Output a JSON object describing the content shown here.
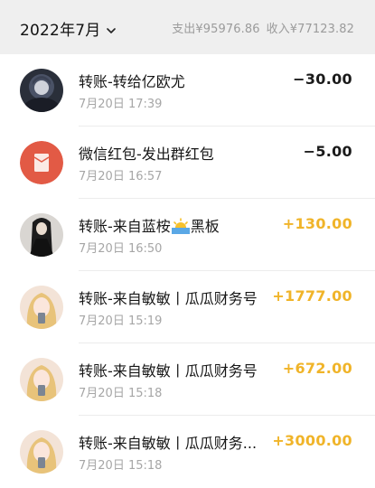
{
  "header": {
    "month": "2022年7月",
    "expense": "支出¥95976.86",
    "income": "收入¥77123.82",
    "month_icon": "chevron-down-icon"
  },
  "colors": {
    "expense_amount": "#1a1a1a",
    "income_amount": "#f0b429",
    "red_packet_bg": "#e25a45"
  },
  "transactions": [
    {
      "title": "转账-转给亿欧尤",
      "time": "7月20日 17:39",
      "amount": "−30.00",
      "type": "expense",
      "avatar": "user-avatar"
    },
    {
      "title": "微信红包-发出群红包",
      "time": "7月20日 16:57",
      "amount": "−5.00",
      "type": "expense",
      "avatar": "red-packet-icon"
    },
    {
      "title_before": "转账-来自蓝桉",
      "title_after": "黑板",
      "emoji": "sunrise-icon",
      "time": "7月20日 16:50",
      "amount": "+130.00",
      "type": "income",
      "avatar": "user-avatar"
    },
    {
      "title": "转账-来自敏敏丨瓜瓜财务号",
      "time": "7月20日 15:19",
      "amount": "+1777.00",
      "type": "income",
      "avatar": "user-avatar"
    },
    {
      "title": "转账-来自敏敏丨瓜瓜财务号",
      "time": "7月20日 15:18",
      "amount": "+672.00",
      "type": "income",
      "avatar": "user-avatar"
    },
    {
      "title": "转账-来自敏敏丨瓜瓜财务...",
      "time": "7月20日 15:18",
      "amount": "+3000.00",
      "type": "income",
      "avatar": "user-avatar"
    }
  ]
}
